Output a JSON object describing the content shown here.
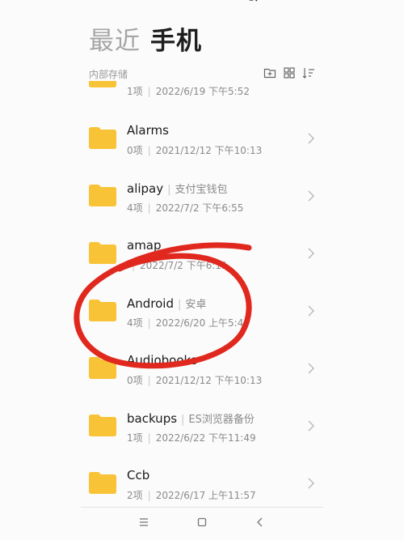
{
  "tabs": {
    "recent": "最近",
    "phone": "手机"
  },
  "storage_label": "内部存储",
  "toolbar": [
    "new-folder-icon",
    "grid-view-icon",
    "sort-icon"
  ],
  "partial_item": {
    "meta": "1项",
    "date": "2022/6/19 下午5:52"
  },
  "items": [
    {
      "name": "Alarms",
      "tag": "",
      "count": "0项",
      "date": "2021/12/12 下午10:13"
    },
    {
      "name": "alipay",
      "tag": "支付宝钱包",
      "count": "4项",
      "date": "2022/7/2 下午6:55"
    },
    {
      "name": "amap",
      "tag": "",
      "count": "",
      "date": "2022/7/2 下午6:11"
    },
    {
      "name": "Android",
      "tag": "安卓",
      "count": "4项",
      "date": "2022/6/20 上午5:40"
    },
    {
      "name": "Audiobooks",
      "tag": "",
      "count": "0项",
      "date": "2021/12/12 下午10:13"
    },
    {
      "name": "backups",
      "tag": "ES浏览器备份",
      "count": "1项",
      "date": "2022/6/22 下午11:49"
    },
    {
      "name": "Ccb",
      "tag": "",
      "count": "2项",
      "date": "2022/6/17 上午11:57"
    }
  ],
  "colors": {
    "folder": "#f8c336",
    "annotation": "#e0281e"
  }
}
